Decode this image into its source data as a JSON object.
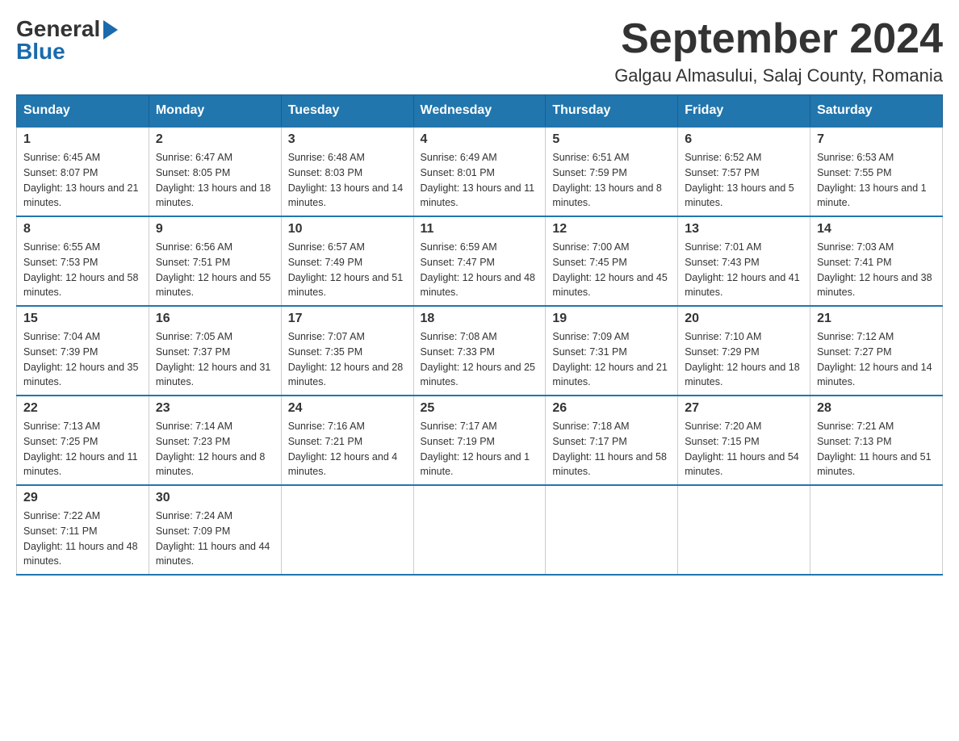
{
  "logo": {
    "general": "General",
    "blue": "Blue"
  },
  "title": {
    "month_year": "September 2024",
    "location": "Galgau Almasului, Salaj County, Romania"
  },
  "weekdays": [
    "Sunday",
    "Monday",
    "Tuesday",
    "Wednesday",
    "Thursday",
    "Friday",
    "Saturday"
  ],
  "weeks": [
    [
      {
        "day": "1",
        "sunrise": "6:45 AM",
        "sunset": "8:07 PM",
        "daylight": "13 hours and 21 minutes."
      },
      {
        "day": "2",
        "sunrise": "6:47 AM",
        "sunset": "8:05 PM",
        "daylight": "13 hours and 18 minutes."
      },
      {
        "day": "3",
        "sunrise": "6:48 AM",
        "sunset": "8:03 PM",
        "daylight": "13 hours and 14 minutes."
      },
      {
        "day": "4",
        "sunrise": "6:49 AM",
        "sunset": "8:01 PM",
        "daylight": "13 hours and 11 minutes."
      },
      {
        "day": "5",
        "sunrise": "6:51 AM",
        "sunset": "7:59 PM",
        "daylight": "13 hours and 8 minutes."
      },
      {
        "day": "6",
        "sunrise": "6:52 AM",
        "sunset": "7:57 PM",
        "daylight": "13 hours and 5 minutes."
      },
      {
        "day": "7",
        "sunrise": "6:53 AM",
        "sunset": "7:55 PM",
        "daylight": "13 hours and 1 minute."
      }
    ],
    [
      {
        "day": "8",
        "sunrise": "6:55 AM",
        "sunset": "7:53 PM",
        "daylight": "12 hours and 58 minutes."
      },
      {
        "day": "9",
        "sunrise": "6:56 AM",
        "sunset": "7:51 PM",
        "daylight": "12 hours and 55 minutes."
      },
      {
        "day": "10",
        "sunrise": "6:57 AM",
        "sunset": "7:49 PM",
        "daylight": "12 hours and 51 minutes."
      },
      {
        "day": "11",
        "sunrise": "6:59 AM",
        "sunset": "7:47 PM",
        "daylight": "12 hours and 48 minutes."
      },
      {
        "day": "12",
        "sunrise": "7:00 AM",
        "sunset": "7:45 PM",
        "daylight": "12 hours and 45 minutes."
      },
      {
        "day": "13",
        "sunrise": "7:01 AM",
        "sunset": "7:43 PM",
        "daylight": "12 hours and 41 minutes."
      },
      {
        "day": "14",
        "sunrise": "7:03 AM",
        "sunset": "7:41 PM",
        "daylight": "12 hours and 38 minutes."
      }
    ],
    [
      {
        "day": "15",
        "sunrise": "7:04 AM",
        "sunset": "7:39 PM",
        "daylight": "12 hours and 35 minutes."
      },
      {
        "day": "16",
        "sunrise": "7:05 AM",
        "sunset": "7:37 PM",
        "daylight": "12 hours and 31 minutes."
      },
      {
        "day": "17",
        "sunrise": "7:07 AM",
        "sunset": "7:35 PM",
        "daylight": "12 hours and 28 minutes."
      },
      {
        "day": "18",
        "sunrise": "7:08 AM",
        "sunset": "7:33 PM",
        "daylight": "12 hours and 25 minutes."
      },
      {
        "day": "19",
        "sunrise": "7:09 AM",
        "sunset": "7:31 PM",
        "daylight": "12 hours and 21 minutes."
      },
      {
        "day": "20",
        "sunrise": "7:10 AM",
        "sunset": "7:29 PM",
        "daylight": "12 hours and 18 minutes."
      },
      {
        "day": "21",
        "sunrise": "7:12 AM",
        "sunset": "7:27 PM",
        "daylight": "12 hours and 14 minutes."
      }
    ],
    [
      {
        "day": "22",
        "sunrise": "7:13 AM",
        "sunset": "7:25 PM",
        "daylight": "12 hours and 11 minutes."
      },
      {
        "day": "23",
        "sunrise": "7:14 AM",
        "sunset": "7:23 PM",
        "daylight": "12 hours and 8 minutes."
      },
      {
        "day": "24",
        "sunrise": "7:16 AM",
        "sunset": "7:21 PM",
        "daylight": "12 hours and 4 minutes."
      },
      {
        "day": "25",
        "sunrise": "7:17 AM",
        "sunset": "7:19 PM",
        "daylight": "12 hours and 1 minute."
      },
      {
        "day": "26",
        "sunrise": "7:18 AM",
        "sunset": "7:17 PM",
        "daylight": "11 hours and 58 minutes."
      },
      {
        "day": "27",
        "sunrise": "7:20 AM",
        "sunset": "7:15 PM",
        "daylight": "11 hours and 54 minutes."
      },
      {
        "day": "28",
        "sunrise": "7:21 AM",
        "sunset": "7:13 PM",
        "daylight": "11 hours and 51 minutes."
      }
    ],
    [
      {
        "day": "29",
        "sunrise": "7:22 AM",
        "sunset": "7:11 PM",
        "daylight": "11 hours and 48 minutes."
      },
      {
        "day": "30",
        "sunrise": "7:24 AM",
        "sunset": "7:09 PM",
        "daylight": "11 hours and 44 minutes."
      },
      null,
      null,
      null,
      null,
      null
    ]
  ]
}
